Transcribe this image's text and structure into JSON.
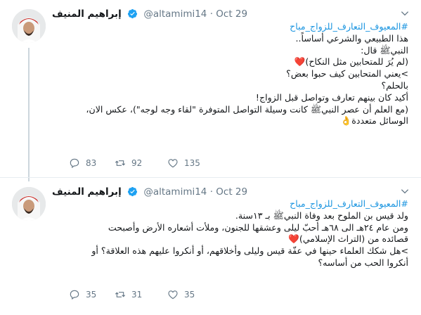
{
  "tweets": [
    {
      "author_name": "إبراهيم المنيف",
      "handle": "@altamimi14",
      "separator": "·",
      "date": "Oct 29",
      "lines": [
        "#المعيوف_التعارف_للزواج_مباح",
        "هذا الطبيعي والشرعي أساساً..",
        "النبيﷺ قال:",
        "(لم يُرَ للمتحابين مثل النكاح)❤️",
        ">يعني المتحابين كيف حبوا بعض؟",
        "بالحلم؟",
        "أكيد كان بينهم تعارف وتواصل قبل الزواج!",
        "(مع العلم أن عصر النبيﷺ كانت وسيلة التواصل المتوفرة \"لقاء وجه لوجه\")، عكس الان،",
        "الوسائل متعددة👌"
      ],
      "replies": "83",
      "retweets": "92",
      "likes": "135"
    },
    {
      "author_name": "إبراهيم المنيف",
      "handle": "@altamimi14",
      "separator": "·",
      "date": "Oct 29",
      "lines": [
        "#المعيوف_التعارف_للزواج_مباح",
        "ولد قيس بن الملوح بعد وفاة النبيﷺ بـ ١٣سنة.",
        "ومن عام ٢٤هـ الى ٦٨هـ أحبّ ليلى وعشقها للجنون، وملأت أشعاره الأرض وأصبحت",
        "قصائده من (التراث الإسلامي)❤️",
        ">هل شكك العلماء حينها في عفّة قيس وليلى وأخلاقهم، أو أنكروا عليهم هذه العلاقة؟ أو",
        "أنكروا الحب من أساسه؟"
      ],
      "replies": "35",
      "retweets": "31",
      "likes": "35"
    }
  ],
  "colors": {
    "hashtag": "#1b95e0",
    "verified": "#1da1f2",
    "meta": "#657786",
    "heart": "#e0245e"
  },
  "icons": [
    "verified-icon",
    "chevron-down-icon",
    "reply-icon",
    "retweet-icon",
    "like-icon"
  ]
}
